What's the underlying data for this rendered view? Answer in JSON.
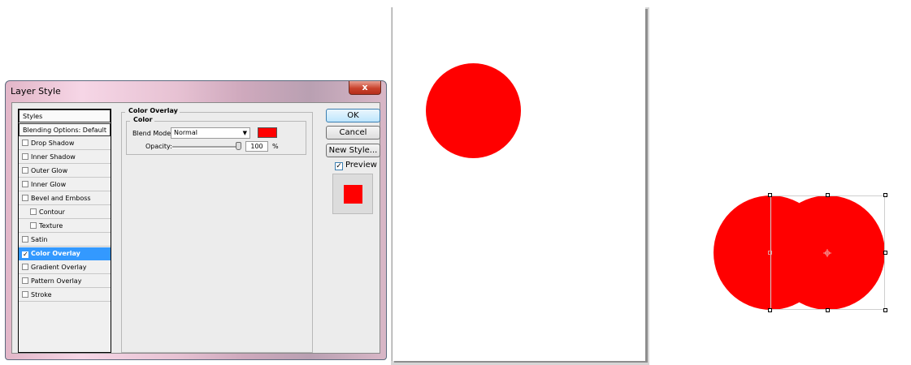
{
  "dialog": {
    "title": "Layer Style",
    "close_label": "x",
    "styles_header": "Styles",
    "blending_options": "Blending Options: Default",
    "effects": [
      {
        "label": "Drop Shadow",
        "checked": false
      },
      {
        "label": "Inner Shadow",
        "checked": false
      },
      {
        "label": "Outer Glow",
        "checked": false
      },
      {
        "label": "Inner Glow",
        "checked": false
      },
      {
        "label": "Bevel and Emboss",
        "checked": false
      },
      {
        "label": "Contour",
        "checked": false
      },
      {
        "label": "Texture",
        "checked": false
      },
      {
        "label": "Satin",
        "checked": false
      },
      {
        "label": "Color Overlay",
        "checked": true
      },
      {
        "label": "Gradient Overlay",
        "checked": false
      },
      {
        "label": "Pattern Overlay",
        "checked": false
      },
      {
        "label": "Stroke",
        "checked": false
      }
    ],
    "panel": {
      "section_title": "Color Overlay",
      "subsection_title": "Color",
      "blend_mode_label": "Blend Mode:",
      "blend_mode_value": "Normal",
      "overlay_color": "#ff0000",
      "opacity_label": "Opacity:",
      "opacity_value": "100",
      "opacity_unit": "%"
    },
    "buttons": {
      "ok": "OK",
      "cancel": "Cancel",
      "new_style": "New Style...",
      "preview_label": "Preview",
      "preview_checked": true
    }
  },
  "colors": {
    "shape_fill": "#ff0000",
    "selection_accent": "#3399ff"
  }
}
